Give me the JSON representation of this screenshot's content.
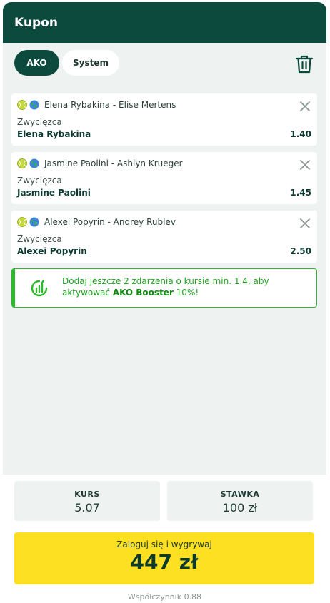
{
  "header": {
    "title": "Kupon"
  },
  "modes": {
    "ako": "AKO",
    "system": "System"
  },
  "bets": [
    {
      "event": "Elena Rybakina - Elise Mertens",
      "market": "Zwycięzca",
      "selection": "Elena Rybakina",
      "odds": "1.40"
    },
    {
      "event": "Jasmine Paolini - Ashlyn Krueger",
      "market": "Zwycięzca",
      "selection": "Jasmine Paolini",
      "odds": "1.45"
    },
    {
      "event": "Alexei Popyrin - Andrey Rublev",
      "market": "Zwycięzca",
      "selection": "Alexei Popyrin",
      "odds": "2.50"
    }
  ],
  "booster": {
    "text_prefix": "Dodaj jeszcze 2 zdarzenia o kursie min. 1.4, aby aktywować ",
    "text_bold": "AKO Booster",
    "text_suffix": " 10%!"
  },
  "summary": {
    "kurs_label": "KURS",
    "kurs_value": "5.07",
    "stawka_label": "STAWKA",
    "stawka_value": "100 zł"
  },
  "cta": {
    "label": "Zaloguj się i wygrywaj",
    "amount": "447 zł"
  },
  "coefficient": "Współczynnik 0.88",
  "icons": {
    "sport": "tennis-ball-icon",
    "region": "globe-icon",
    "remove": "close-icon",
    "trash": "trash-icon",
    "booster": "booster-icon"
  },
  "colors": {
    "brand_dark": "#0c4a3d",
    "cta_yellow": "#fde021",
    "booster_green": "#2eb82e",
    "panel_bg": "#eef2f1"
  }
}
